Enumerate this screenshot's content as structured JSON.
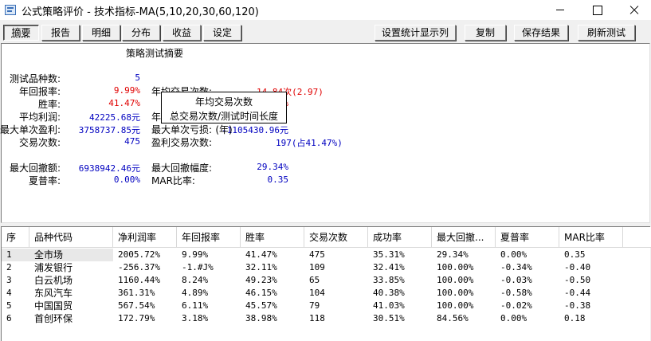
{
  "window": {
    "title": "公式策略评价 - 技术指标-MA(5,10,20,30,60,120)"
  },
  "toolbar": {
    "tabs": [
      "摘要",
      "报告",
      "明细",
      "分布",
      "收益",
      "设定"
    ],
    "settings_button": "设置统计显示列",
    "copy_button": "复制",
    "save_button": "保存结果",
    "refresh_button": "刷新测试"
  },
  "summary": {
    "title": "策略测试摘要",
    "test_count_label": "测试品种数:",
    "test_count_value": "5",
    "annual_return_label": "年回报率:",
    "annual_return_value": "9.99%",
    "win_rate_label": "胜率:",
    "win_rate_value": "41.47%",
    "win_rate_right_value": "%",
    "avg_profit_label": "平均利润:",
    "avg_profit_value": "42225.68元",
    "max_single_profit_label": "最大单次盈利:",
    "max_single_profit_value": "3758737.85元",
    "trade_count_label": "交易次数:",
    "trade_count_value": "475",
    "max_drawdown_amount_label": "最大回撤额:",
    "max_drawdown_amount_value": "6938942.46元",
    "sharpe_label": "夏普率:",
    "sharpe_value": "0.00%",
    "annual_trades_label": "年均交易次数:",
    "annual_trades_value": "14.84次",
    "annual_trades_extra": "(2.97)",
    "annual_trades_formula_prefix": "年",
    "annual_trades_formula_tail": "",
    "max_single_loss_label": "最大单次亏损:",
    "max_single_loss_value": "-1105430.96元",
    "profit_trades_label": "盈利交易次数:",
    "profit_trades_value": "197(占41.47%)",
    "max_drawdown_pct_label": "最大回撤幅度:",
    "max_drawdown_pct_value": "29.34%",
    "mar_label": "MAR比率:",
    "mar_value": "0.35"
  },
  "tooltip": {
    "title": "年均交易次数",
    "body": "总交易次数/测试时间长度(年)"
  },
  "table": {
    "columns": [
      "序",
      "品种代码",
      "净利润率",
      "年回报率",
      "胜率",
      "交易次数",
      "成功率",
      "最大回撤...",
      "夏普率",
      "MAR比率"
    ],
    "rows": [
      [
        "1",
        "全市场",
        "2005.72%",
        "9.99%",
        "41.47%",
        "475",
        "35.31%",
        "29.34%",
        "0.00%",
        "0.35"
      ],
      [
        "2",
        "浦发银行",
        "-256.37%",
        "-1.#J%",
        "32.11%",
        "109",
        "32.41%",
        "100.00%",
        "-0.34%",
        "-0.40"
      ],
      [
        "3",
        "白云机场",
        "1160.44%",
        "8.24%",
        "49.23%",
        "65",
        "33.85%",
        "100.00%",
        "-0.03%",
        "-0.50"
      ],
      [
        "4",
        "东风汽车",
        "361.31%",
        "4.89%",
        "46.15%",
        "104",
        "40.38%",
        "100.00%",
        "-0.58%",
        "-0.44"
      ],
      [
        "5",
        "中国国贸",
        "567.54%",
        "6.11%",
        "45.57%",
        "79",
        "41.03%",
        "100.00%",
        "-0.02%",
        "-0.38"
      ],
      [
        "6",
        "首创环保",
        "172.79%",
        "3.18%",
        "38.98%",
        "118",
        "30.51%",
        "84.56%",
        "0.00%",
        "0.18"
      ]
    ]
  }
}
